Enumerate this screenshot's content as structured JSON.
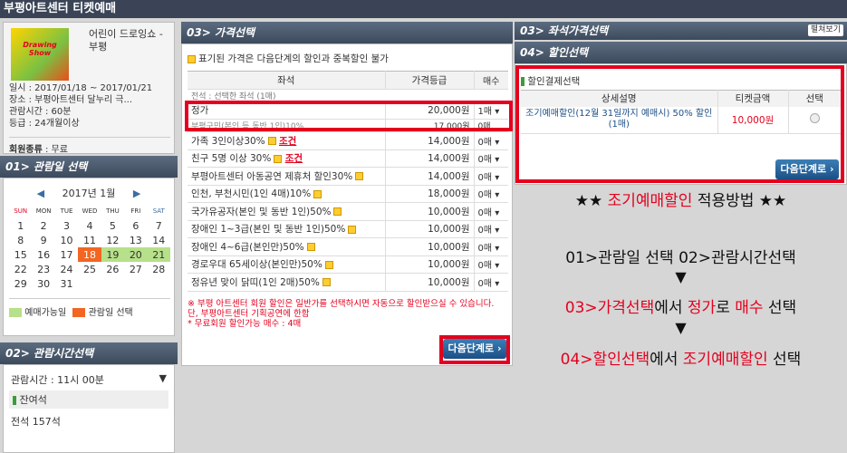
{
  "app_title": "부평아트센터 티켓예매",
  "show": {
    "name": "어린이 드로잉쇼 - 부평",
    "poster_text": "Drawing Show",
    "date": "일시 : 2017/01/18 ~ 2017/01/21",
    "place": "장소 : 부평아트센터 달누리 극...",
    "runtime": "관람시간 : 60분",
    "grade": "등급 : 24개월이상"
  },
  "member": {
    "label": "회원종류",
    "value": ": 무료"
  },
  "section1": {
    "title": "01> 관람일 선택"
  },
  "calendar": {
    "month": "2017년 1월",
    "weekdays": [
      "SUN",
      "MON",
      "TUE",
      "WED",
      "THU",
      "FRI",
      "SAT"
    ],
    "rows": [
      [
        "1",
        "2",
        "3",
        "4",
        "5",
        "6",
        "7"
      ],
      [
        "8",
        "9",
        "10",
        "11",
        "12",
        "13",
        "14"
      ],
      [
        "15",
        "16",
        "17",
        "18",
        "19",
        "20",
        "21"
      ],
      [
        "22",
        "23",
        "24",
        "25",
        "26",
        "27",
        "28"
      ],
      [
        "29",
        "30",
        "31",
        "",
        "",
        "",
        ""
      ]
    ],
    "legend_available": "예매가능일",
    "legend_selected": "관람일 선택"
  },
  "section2": {
    "title": "02> 관람시간선택",
    "time": "관람시간 : 11시 00분",
    "remain": "잔여석",
    "seats": "전석 157석"
  },
  "section3": {
    "title": "03> 가격선택",
    "note": "표기된 가격은 다음단계의 할인과 중복할인 불가",
    "col_seat": "좌석",
    "col_grade": "가격등급",
    "col_qty": "매수",
    "group": "전석 : 선택한 좌석 (1매)",
    "rows": [
      {
        "name": "정가",
        "price": "20,000원",
        "qty": "1매"
      },
      {
        "name": "부평구민(본인 등 동반 1인)10%",
        "price": "17,000원",
        "qty": "0매"
      },
      {
        "name": "가족 3인이상30%",
        "price": "14,000원",
        "qty": "0매",
        "cond": "조건"
      },
      {
        "name": "친구 5명 이상 30%",
        "price": "14,000원",
        "qty": "0매",
        "cond": "조건"
      },
      {
        "name": "부평아트센터 아동공연 제휴처 할인30%",
        "price": "14,000원",
        "qty": "0매"
      },
      {
        "name": "인천, 부천시민(1인 4매)10%",
        "price": "18,000원",
        "qty": "0매"
      },
      {
        "name": "국가유공자(본인 및 동반 1인)50%",
        "price": "10,000원",
        "qty": "0매"
      },
      {
        "name": "장애인 1~3급(본인 및 동반 1인)50%",
        "price": "10,000원",
        "qty": "0매"
      },
      {
        "name": "장애인 4~6급(본인만)50%",
        "price": "10,000원",
        "qty": "0매"
      },
      {
        "name": "경로우대 65세이상(본인만)50%",
        "price": "10,000원",
        "qty": "0매"
      },
      {
        "name": "정유년 맞이 닭띠(1인 2매)50%",
        "price": "10,000원",
        "qty": "0매"
      }
    ],
    "footnote1": "※ 부평 아트센터 회원 할인은 일반가를 선택하시면 자동으로 할인받으실 수 있습니다. 단, 부평아트센터 기획공연에 한함",
    "footnote2": "* 무료회원 할인가능 매수 : 4매",
    "next": "다음단계로"
  },
  "section_seat": {
    "title": "03> 좌석가격선택",
    "view": "펼쳐보기"
  },
  "section4": {
    "title": "04> 할인선택",
    "sub": "할인결제선택",
    "col_desc": "상세설명",
    "col_price": "티켓금액",
    "col_sel": "선택",
    "row": {
      "desc": "조기예매할인(12월 31일까지 예매시) 50% 할인 (1매)",
      "price": "10,000원"
    },
    "next": "다음단계로"
  },
  "guide": {
    "line1_a": "★★ ",
    "line1_b": "조기예매할인",
    "line1_c": " 적용방법 ★★",
    "line2": "01>관람일 선택 02>관람시간선택",
    "arrow": "▼",
    "line3_a": "03>가격선택",
    "line3_b": "에서 ",
    "line3_c": "정가",
    "line3_d": "로 ",
    "line3_e": "매수",
    "line3_f": " 선택",
    "line4_a": "04>할인선택",
    "line4_b": "에서 ",
    "line4_c": "조기예매할인",
    "line4_d": " 선택"
  }
}
